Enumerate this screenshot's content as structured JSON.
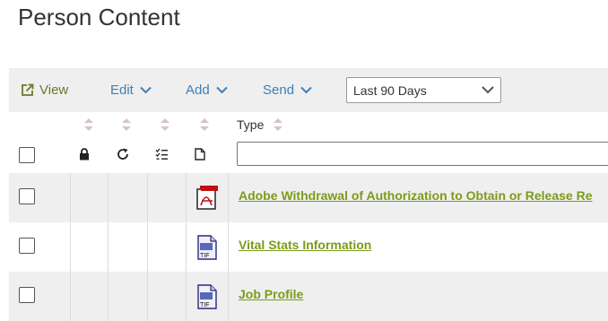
{
  "page_title": "Person Content",
  "toolbar": {
    "view_label": "View",
    "edit_label": "Edit",
    "add_label": "Add",
    "send_label": "Send",
    "date_filter": {
      "selected": "Last 90 Days"
    }
  },
  "table": {
    "columns": {
      "lock_icon": "lock-icon",
      "refresh_icon": "refresh-icon",
      "checklist_icon": "checklist-icon",
      "document_icon": "document-icon",
      "type_label": "Type"
    },
    "rows": [
      {
        "icon": "pdf-file-icon",
        "title": "Adobe Withdrawal of Authorization to Obtain or Release Re"
      },
      {
        "icon": "tif-file-icon",
        "title": "Vital Stats Information"
      },
      {
        "icon": "tif-file-icon",
        "title": "Job Profile"
      }
    ]
  },
  "colors": {
    "view_green": "#6a7a2a",
    "action_blue": "#3f7fb3",
    "link_green": "#7d9a1a",
    "toolbar_bg": "#efefef"
  }
}
